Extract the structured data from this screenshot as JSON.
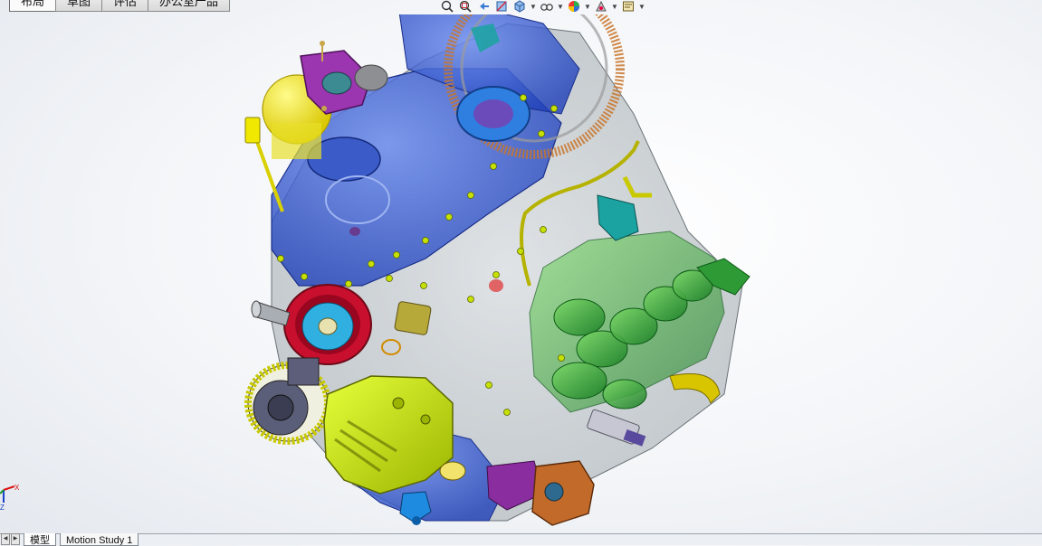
{
  "command_tabs": [
    {
      "label": "布局"
    },
    {
      "label": "草图"
    },
    {
      "label": "评估"
    },
    {
      "label": "办公室产品"
    }
  ],
  "active_command_tab": 0,
  "hud_tools": [
    {
      "icon": "zoom-to-fit-icon"
    },
    {
      "icon": "zoom-area-icon"
    },
    {
      "icon": "previous-view-icon"
    },
    {
      "icon": "section-view-icon"
    },
    {
      "icon": "view-orientation-icon"
    },
    {
      "icon": "display-style-icon"
    },
    {
      "icon": "hide-show-items-icon"
    },
    {
      "icon": "edit-appearance-icon"
    },
    {
      "icon": "apply-scene-icon"
    },
    {
      "icon": "view-settings-icon"
    }
  ],
  "bottom_tabs": [
    {
      "label": "模型"
    },
    {
      "label": "Motion Study 1"
    }
  ],
  "active_bottom_tab": 0,
  "triad": {
    "x_label": "X",
    "z_label": "Z"
  },
  "colors": {
    "block_blue": "#2f55d8",
    "pulley_red": "#c8102e",
    "bracket_lime": "#c6e000",
    "manifold_green": "#1f9c2a",
    "flywheel_orange": "#c9752a",
    "purple_part": "#8a2d9e",
    "teal_part": "#1aa3a0",
    "yellow_tank": "#f2ea00"
  }
}
